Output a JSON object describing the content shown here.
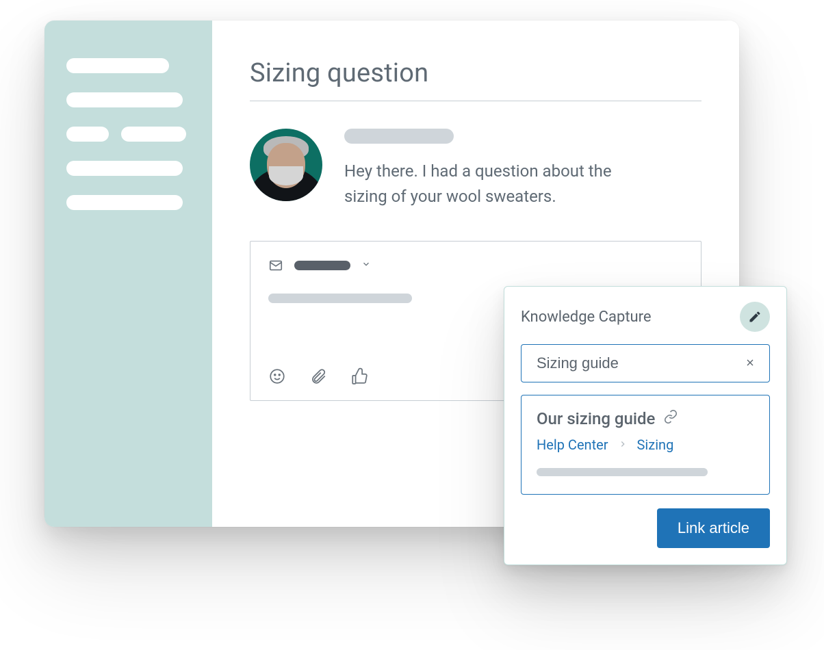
{
  "ticket": {
    "title": "Sizing question",
    "message": "Hey there. I had a question about the sizing of your wool sweaters."
  },
  "knowledge": {
    "panel_title": "Knowledge Capture",
    "search_value": "Sizing guide",
    "result": {
      "title": "Our sizing guide",
      "breadcrumb": {
        "root": "Help Center",
        "section": "Sizing"
      }
    },
    "link_button": "Link article"
  },
  "colors": {
    "accent": "#1f73b7",
    "sidebar": "#c4dedc",
    "text": "#5f6a74"
  },
  "icons": {
    "edit": "pencil-icon",
    "close": "close-icon",
    "link": "link-icon",
    "mail": "mail-icon",
    "emoji": "emoji-icon",
    "attach": "paperclip-icon",
    "thumbs_up": "thumbs-up-icon",
    "chevron_down": "chevron-down-icon",
    "chevron_right": "chevron-right-icon"
  }
}
